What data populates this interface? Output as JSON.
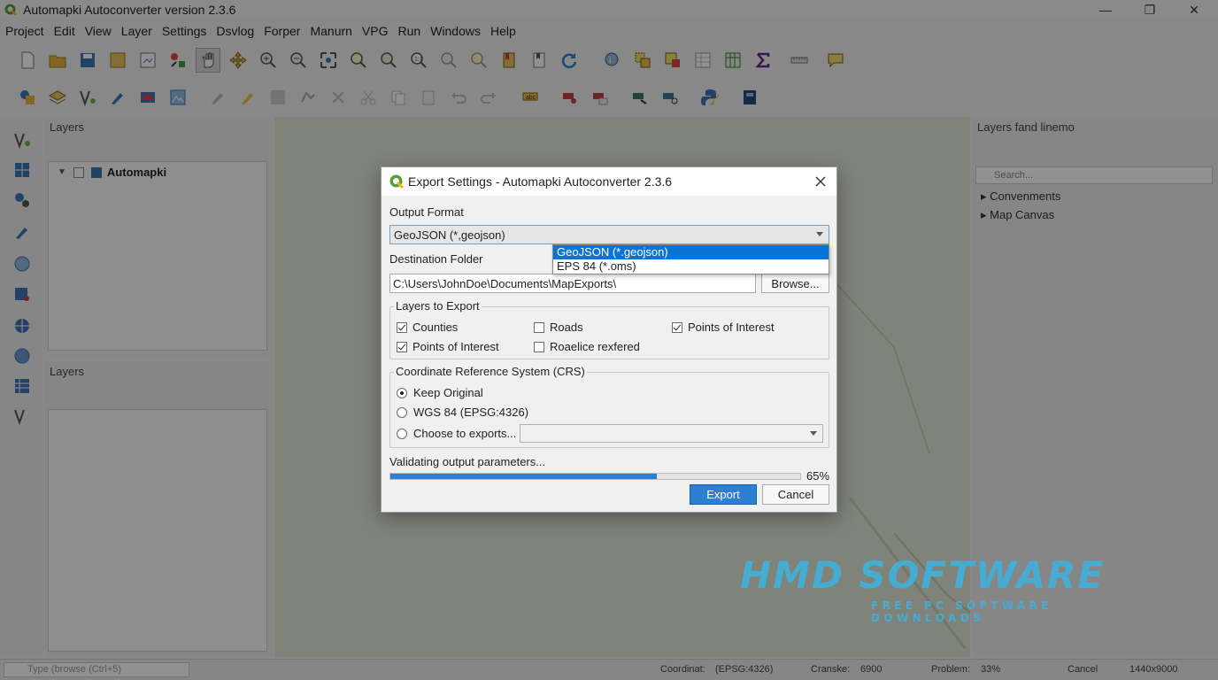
{
  "window": {
    "title": "Automapki Autoconverter version 2.3.6",
    "controls": {
      "minimize": "—",
      "restore": "❐",
      "close": "✕"
    }
  },
  "menubar": [
    "Project",
    "Edit",
    "View",
    "Layer",
    "Settings",
    "Dsvlog",
    "Forper",
    "Manurn",
    "VPG",
    "Run",
    "Windows",
    "Help"
  ],
  "left_panel": {
    "title": "Layers",
    "tree_item": "Automapki",
    "second_title": "Layers"
  },
  "right_panel": {
    "title": "Layers fand linemo",
    "search_placeholder": "Search...",
    "items": [
      "Convenments",
      "Map Canvas"
    ]
  },
  "statusbar": {
    "search_placeholder": "Type (browse (Ctrl+5)",
    "coordinate_label": "Coordinat:",
    "coordinate_value": "(EPSG:4326)",
    "scale_label": "Cranske:",
    "scale_value": "6900",
    "problem_label": "Problem:",
    "problem_value": "33%",
    "cancel_label": "Cancel",
    "render_value": "1440x9000"
  },
  "watermark": {
    "big": "HMD SOFTWARE",
    "small": "FREE PC SOFTWARE DOWNLOADS"
  },
  "dialog": {
    "title": "Export Settings - Automapki Autoconverter 2.3.6",
    "output_format_label": "Output Format",
    "output_format_value": "GeoJSON (*,geojson)",
    "format_options": [
      {
        "label": "GeoJSON (*.geojson)",
        "selected": true
      },
      {
        "label": "EPS 84 (*.oms)",
        "selected": false
      }
    ],
    "destination_label": "Destination Folder",
    "destination_value": "C:\\Users\\JohnDoe\\Documents\\MapExports\\",
    "browse_label": "Browse...",
    "layers_group_title": "Layers to Export",
    "layers": [
      {
        "label": "Counties",
        "checked": true
      },
      {
        "label": "Roads",
        "checked": false
      },
      {
        "label": "Points of Interest",
        "checked": true
      },
      {
        "label": "Points of Interest",
        "checked": true
      },
      {
        "label": "Roaelice rexfered",
        "checked": false
      }
    ],
    "crs_group_title": "Coordinate Reference System (CRS)",
    "crs_options": [
      {
        "label": "Keep Original",
        "selected": true
      },
      {
        "label": "WGS 84 (EPSG:4326)",
        "selected": false
      },
      {
        "label": "Choose to exports...",
        "selected": false
      }
    ],
    "crs_custom_value": "",
    "status_text": "Validating output parameters...",
    "progress": 0.65,
    "progress_text": "65%",
    "export_label": "Export",
    "cancel_label": "Cancel"
  },
  "colors": {
    "accent": "#2d7fd3",
    "selected_option": "#0a74d6",
    "watermark": "#3fb0dc",
    "map_canvas": "#dfe7d7"
  }
}
